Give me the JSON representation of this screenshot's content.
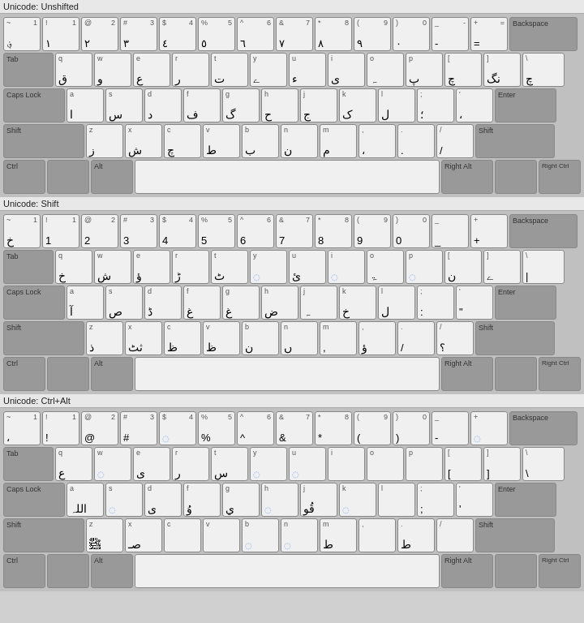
{
  "sections": [
    {
      "label": "Unicode: Unshifted"
    },
    {
      "label": "Unicode: Shift"
    },
    {
      "label": "Unicode: Ctrl+Alt"
    }
  ],
  "keys": {
    "backspace": "Backspace",
    "tab": "Tab",
    "capslock": "Caps Lock",
    "enter": "Enter",
    "shift": "Shift",
    "ctrl": "Ctrl",
    "alt": "Alt",
    "right_alt": "Right Alt",
    "right_ctrl": "Right Ctrl",
    "space": ""
  }
}
